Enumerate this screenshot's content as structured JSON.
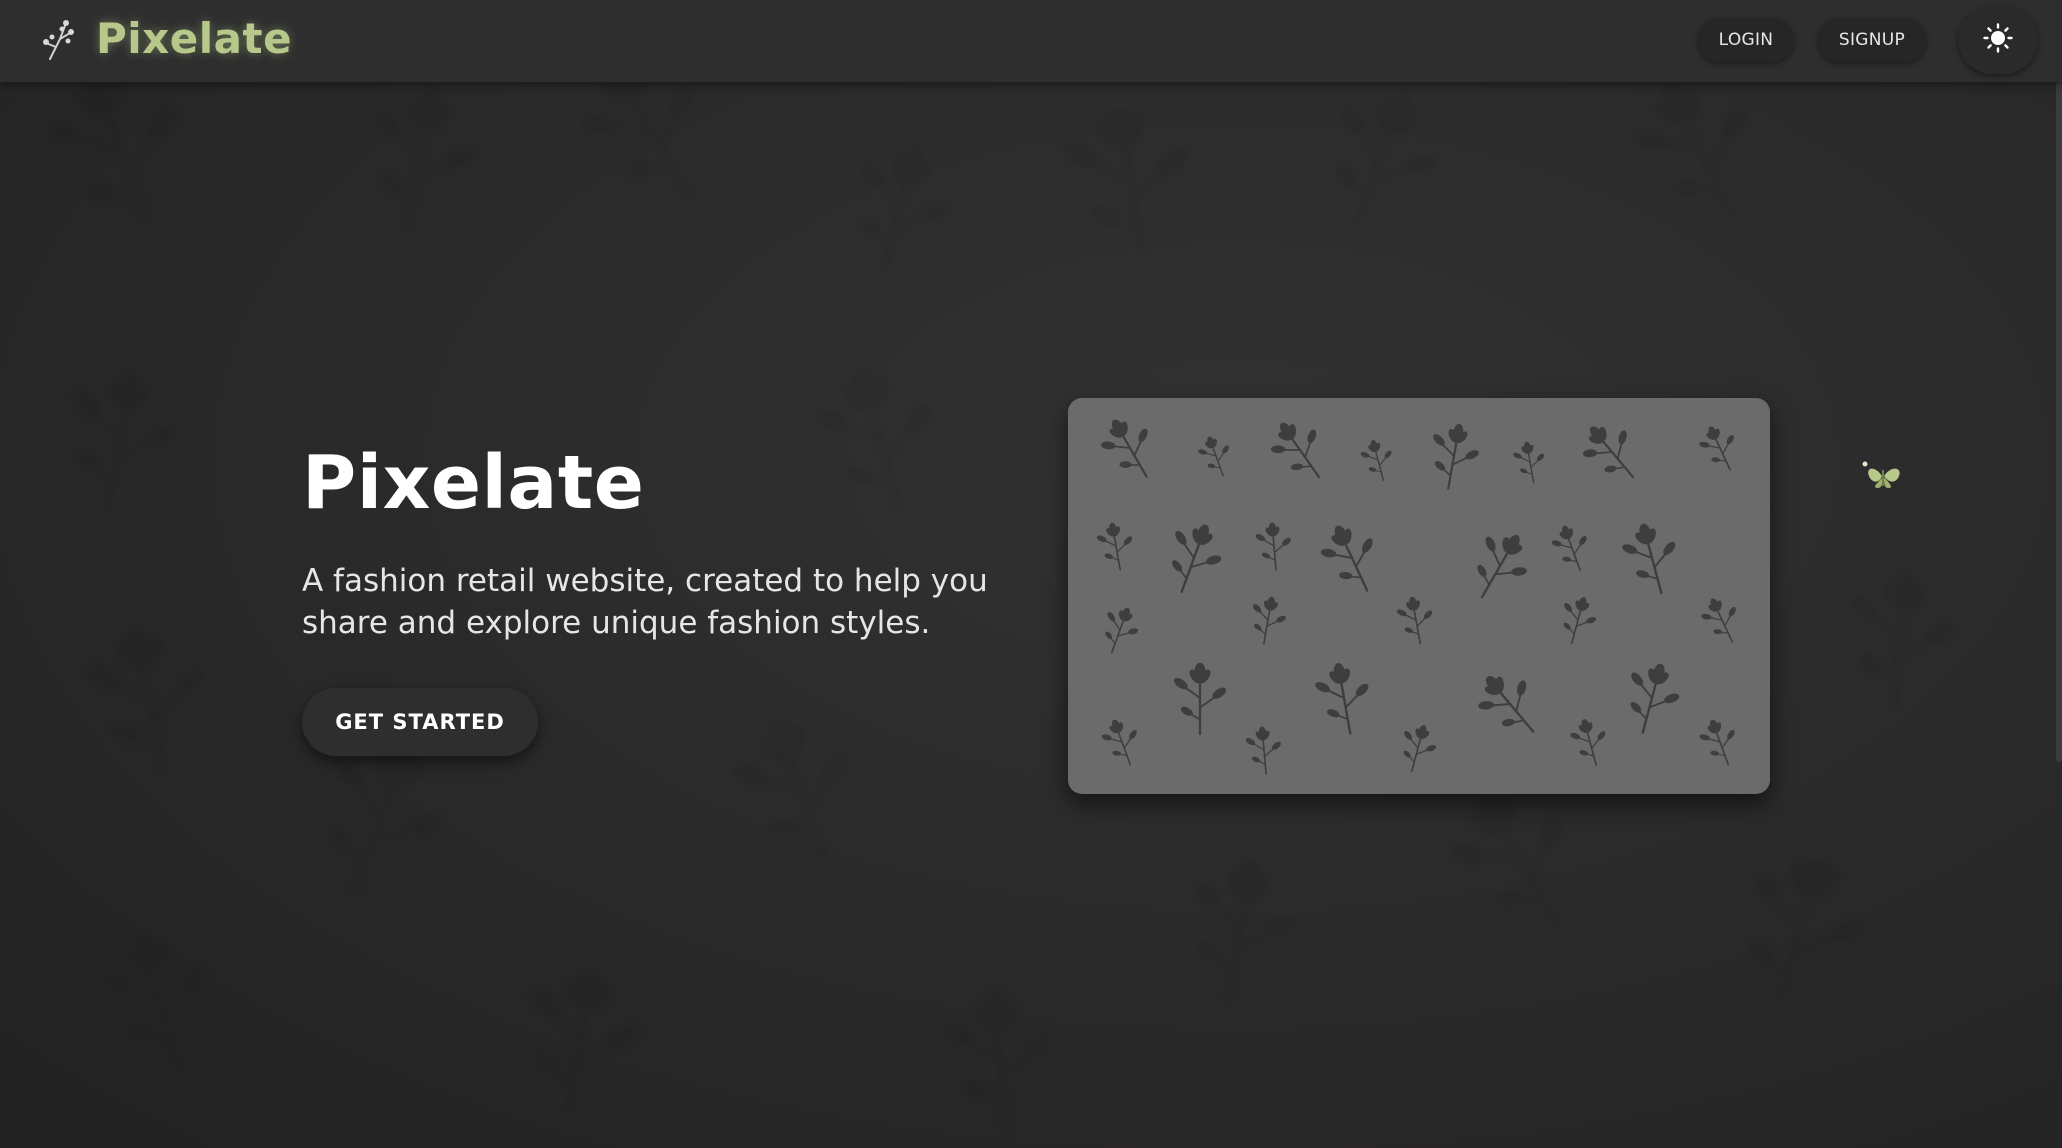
{
  "navbar": {
    "brand_name": "Pixelate",
    "brand_icon": "flower-sprig-icon",
    "login_label": "LOGIN",
    "signup_label": "SIGNUP",
    "theme_toggle_icon": "sun-icon"
  },
  "hero": {
    "title": "Pixelate",
    "subtitle": "A fashion retail website, created to help you share and explore unique fashion styles.",
    "cta_label": "GET STARTED"
  },
  "decor": {
    "pattern_image": "floral-pattern-image",
    "butterfly_icon": "butterfly-icon"
  },
  "colors": {
    "accent": "#b7c98a",
    "background": "#2b2b2b",
    "card": "#6b6b6b"
  }
}
